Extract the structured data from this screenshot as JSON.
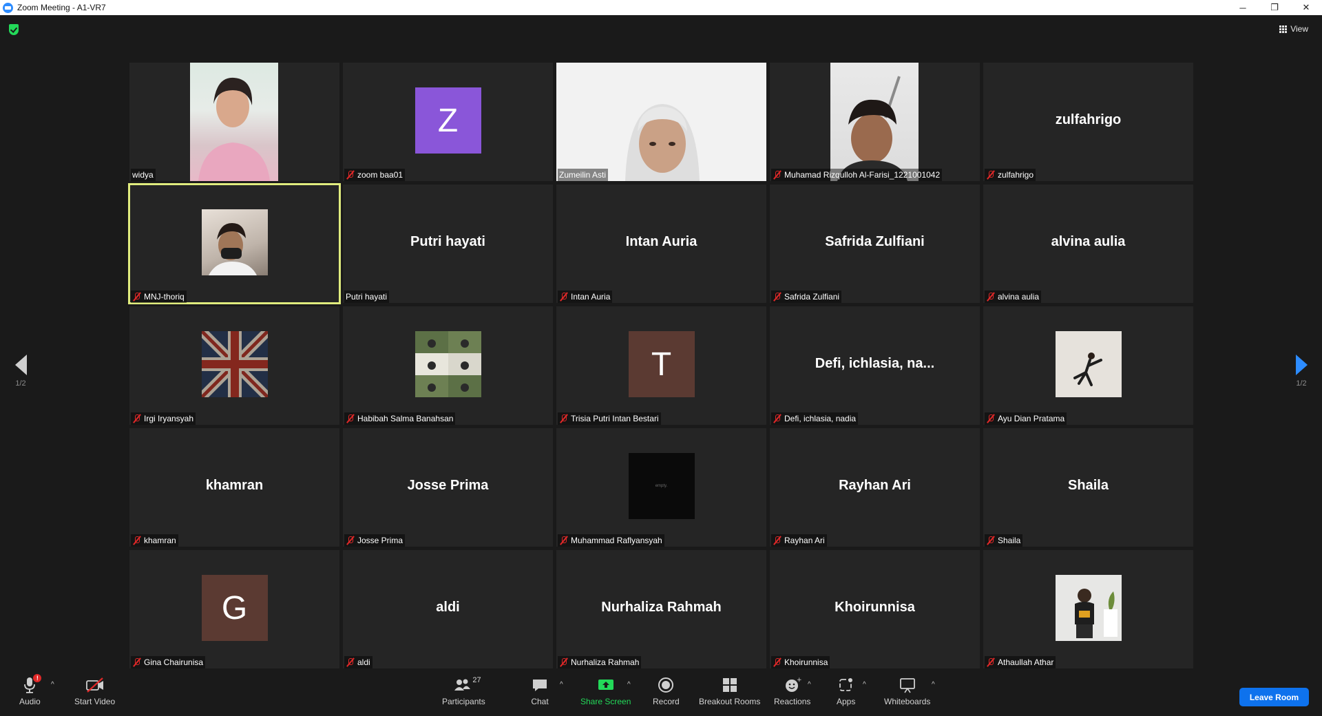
{
  "window": {
    "title": "Zoom Meeting - A1-VR7",
    "controls": {
      "minimize": "─",
      "restore": "❐",
      "close": "✕"
    }
  },
  "top": {
    "view_label": "View",
    "security_icon": "shield-check-icon",
    "security_color": "#23d959"
  },
  "pager": {
    "left_label": "1/2",
    "right_label": "1/2",
    "right_arrow_color": "#2d8cff"
  },
  "participants": [
    {
      "name": "widya",
      "muted": false,
      "kind": "video"
    },
    {
      "name": "zoom baa01",
      "muted": true,
      "kind": "avatar",
      "letter": "Z",
      "color": "#8a56d9"
    },
    {
      "name": "Zumeilin Asti",
      "muted": false,
      "kind": "video"
    },
    {
      "name": "Muhamad Rizqulloh Al-Farisi_1221001042",
      "muted": true,
      "kind": "video"
    },
    {
      "name": "zulfahrigo",
      "muted": true,
      "kind": "name",
      "display": "zulfahrigo"
    },
    {
      "name": "MNJ-thoriq",
      "muted": true,
      "kind": "photo",
      "active": true
    },
    {
      "name": "Putri hayati",
      "muted": false,
      "kind": "name",
      "display": "Putri hayati"
    },
    {
      "name": "Intan Auria",
      "muted": true,
      "kind": "name",
      "display": "Intan Auria"
    },
    {
      "name": "Safrida Zulfiani",
      "muted": true,
      "kind": "name",
      "display": "Safrida Zulfiani"
    },
    {
      "name": "alvina aulia",
      "muted": true,
      "kind": "name",
      "display": "alvina aulia"
    },
    {
      "name": "Irgi Iryansyah",
      "muted": true,
      "kind": "photo"
    },
    {
      "name": "Habibah Salma Banahsan",
      "muted": true,
      "kind": "photo"
    },
    {
      "name": "Trisia Putri Intan Bestari",
      "muted": true,
      "kind": "avatar",
      "letter": "T",
      "color": "#5b3a32"
    },
    {
      "name": "Defi, ichlasia, nadia",
      "muted": true,
      "kind": "name",
      "display": "Defi,  ichlasia,  na..."
    },
    {
      "name": "Ayu Dian Pratama",
      "muted": true,
      "kind": "photo"
    },
    {
      "name": "khamran",
      "muted": true,
      "kind": "name",
      "display": "khamran"
    },
    {
      "name": "Josse Prima",
      "muted": true,
      "kind": "name",
      "display": "Josse Prima"
    },
    {
      "name": "Muhammad Raflyansyah",
      "muted": true,
      "kind": "photo",
      "photo_text": "empty."
    },
    {
      "name": "Rayhan Ari",
      "muted": true,
      "kind": "name",
      "display": "Rayhan Ari"
    },
    {
      "name": "Shaila",
      "muted": true,
      "kind": "name",
      "display": "Shaila"
    },
    {
      "name": "Gina Chairunisa",
      "muted": true,
      "kind": "avatar",
      "letter": "G",
      "color": "#5b3a32"
    },
    {
      "name": "aldi",
      "muted": true,
      "kind": "name",
      "display": "aldi"
    },
    {
      "name": "Nurhaliza Rahmah",
      "muted": true,
      "kind": "name",
      "display": "Nurhaliza Rahmah"
    },
    {
      "name": "Khoirunnisa",
      "muted": true,
      "kind": "name",
      "display": "Khoirunnisa"
    },
    {
      "name": "Athaullah Athar",
      "muted": true,
      "kind": "photo"
    }
  ],
  "toolbar": {
    "audio": "Audio",
    "audio_badge": "!",
    "start_video": "Start Video",
    "participants": "Participants",
    "participants_count": "27",
    "chat": "Chat",
    "share_screen": "Share Screen",
    "share_color": "#23d959",
    "record": "Record",
    "breakout_rooms": "Breakout Rooms",
    "reactions": "Reactions",
    "apps": "Apps",
    "whiteboards": "Whiteboards",
    "leave_room": "Leave Room",
    "caret": "^"
  }
}
